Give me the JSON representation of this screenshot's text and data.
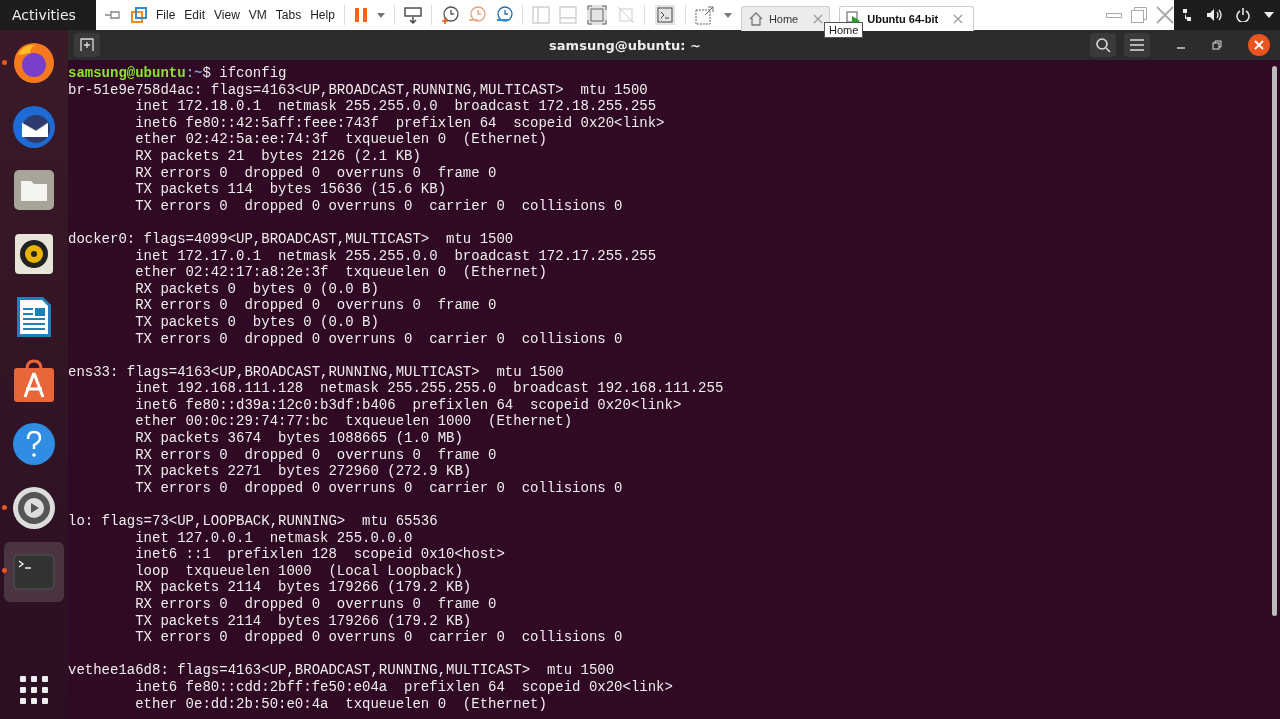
{
  "top_bar": {
    "activities": "Activities"
  },
  "vm_toolbar": {
    "menus": [
      "File",
      "Edit",
      "View",
      "VM",
      "Tabs",
      "Help"
    ],
    "tabs": [
      {
        "label": "Home",
        "selected": false
      },
      {
        "label": "Ubuntu 64-bit",
        "selected": true
      }
    ],
    "tooltip": "Home"
  },
  "dock": {
    "items": [
      {
        "kind": "firefox",
        "running": true,
        "selected": false
      },
      {
        "kind": "thunderbird",
        "running": false,
        "selected": false
      },
      {
        "kind": "files",
        "running": false,
        "selected": false
      },
      {
        "kind": "rhythmbox",
        "running": false,
        "selected": false
      },
      {
        "kind": "writer",
        "running": false,
        "selected": false
      },
      {
        "kind": "software",
        "running": false,
        "selected": false
      },
      {
        "kind": "help",
        "running": false,
        "selected": false
      },
      {
        "kind": "settings",
        "running": true,
        "selected": false
      },
      {
        "kind": "terminal",
        "running": true,
        "selected": true
      }
    ]
  },
  "terminal": {
    "title": "samsung@ubuntu: ~",
    "prompt": {
      "user_host": "samsung@ubuntu",
      "path": ":~",
      "symbol": "$",
      "command": "ifconfig"
    },
    "blocks": [
      {
        "header": "br-51e9e758d4ac: flags=4163<UP,BROADCAST,RUNNING,MULTICAST>  mtu 1500",
        "lines": [
          "inet 172.18.0.1  netmask 255.255.0.0  broadcast 172.18.255.255",
          "inet6 fe80::42:5aff:feee:743f  prefixlen 64  scopeid 0x20<link>",
          "ether 02:42:5a:ee:74:3f  txqueuelen 0  (Ethernet)",
          "RX packets 21  bytes 2126 (2.1 KB)",
          "RX errors 0  dropped 0  overruns 0  frame 0",
          "TX packets 114  bytes 15636 (15.6 KB)",
          "TX errors 0  dropped 0 overruns 0  carrier 0  collisions 0"
        ]
      },
      {
        "header": "docker0: flags=4099<UP,BROADCAST,MULTICAST>  mtu 1500",
        "lines": [
          "inet 172.17.0.1  netmask 255.255.0.0  broadcast 172.17.255.255",
          "ether 02:42:17:a8:2e:3f  txqueuelen 0  (Ethernet)",
          "RX packets 0  bytes 0 (0.0 B)",
          "RX errors 0  dropped 0  overruns 0  frame 0",
          "TX packets 0  bytes 0 (0.0 B)",
          "TX errors 0  dropped 0 overruns 0  carrier 0  collisions 0"
        ]
      },
      {
        "header": "ens33: flags=4163<UP,BROADCAST,RUNNING,MULTICAST>  mtu 1500",
        "lines": [
          "inet 192.168.111.128  netmask 255.255.255.0  broadcast 192.168.111.255",
          "inet6 fe80::d39a:12c0:b3df:b406  prefixlen 64  scopeid 0x20<link>",
          "ether 00:0c:29:74:77:bc  txqueuelen 1000  (Ethernet)",
          "RX packets 3674  bytes 1088665 (1.0 MB)",
          "RX errors 0  dropped 0  overruns 0  frame 0",
          "TX packets 2271  bytes 272960 (272.9 KB)",
          "TX errors 0  dropped 0 overruns 0  carrier 0  collisions 0"
        ]
      },
      {
        "header": "lo: flags=73<UP,LOOPBACK,RUNNING>  mtu 65536",
        "lines": [
          "inet 127.0.0.1  netmask 255.0.0.0",
          "inet6 ::1  prefixlen 128  scopeid 0x10<host>",
          "loop  txqueuelen 1000  (Local Loopback)",
          "RX packets 2114  bytes 179266 (179.2 KB)",
          "RX errors 0  dropped 0  overruns 0  frame 0",
          "TX packets 2114  bytes 179266 (179.2 KB)",
          "TX errors 0  dropped 0 overruns 0  carrier 0  collisions 0"
        ]
      },
      {
        "header": "vethee1a6d8: flags=4163<UP,BROADCAST,RUNNING,MULTICAST>  mtu 1500",
        "lines": [
          "inet6 fe80::cdd:2bff:fe50:e04a  prefixlen 64  scopeid 0x20<link>",
          "ether 0e:dd:2b:50:e0:4a  txqueuelen 0  (Ethernet)"
        ]
      }
    ]
  }
}
